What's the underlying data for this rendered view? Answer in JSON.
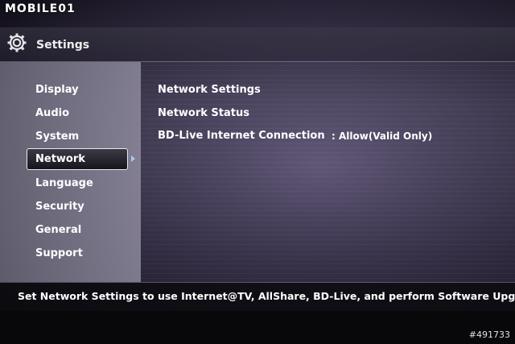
{
  "watermark": "MOBILE01",
  "header": {
    "title": "Settings",
    "icon": "gear-icon"
  },
  "sidebar": {
    "items": [
      {
        "label": "Display"
      },
      {
        "label": "Audio"
      },
      {
        "label": "System"
      },
      {
        "label": "Network",
        "selected": true
      },
      {
        "label": "Language"
      },
      {
        "label": "Security"
      },
      {
        "label": "General"
      },
      {
        "label": "Support"
      }
    ]
  },
  "network": {
    "options": [
      {
        "label": "Network Settings",
        "value": ""
      },
      {
        "label": "Network Status",
        "value": ""
      },
      {
        "label": "BD-Live Internet Connection",
        "value": ": Allow(Valid Only)"
      }
    ]
  },
  "help": {
    "text": "Set Network Settings to use Internet@TV, AllShare, BD-Live, and perform Software Upgrade."
  },
  "image_id": "#491733",
  "colors": {
    "selection_border": "#e8e8f0",
    "arrow": "#a8c8f0",
    "text": "#ffffff"
  }
}
